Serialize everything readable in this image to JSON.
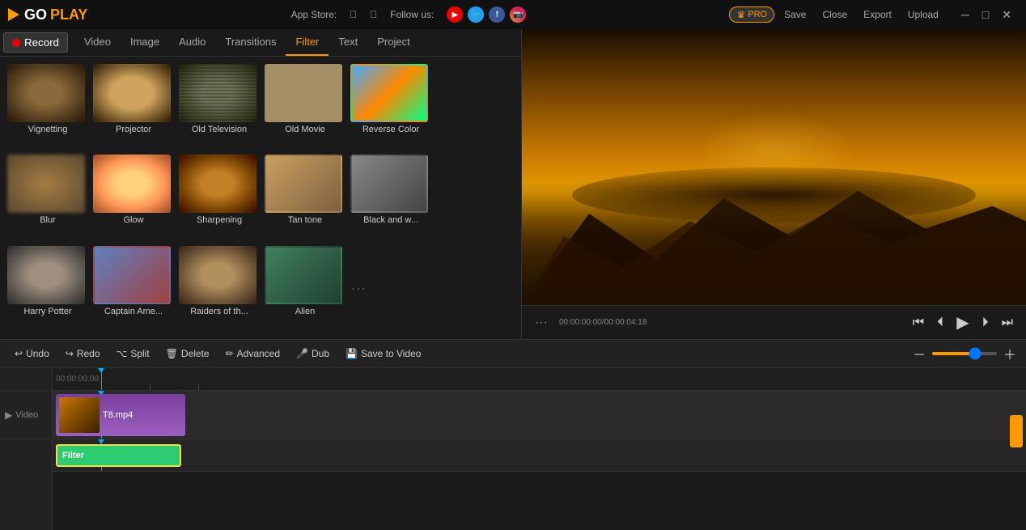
{
  "app": {
    "logo_go": "GO",
    "logo_play": "PLAY"
  },
  "titlebar": {
    "app_store_label": "App Store:",
    "follow_label": "Follow us:",
    "pro_label": "PRO",
    "save_btn": "Save",
    "close_btn": "Close",
    "export_btn": "Export",
    "upload_btn": "Upload"
  },
  "record_btn": "Record",
  "tabs": {
    "items": [
      {
        "label": "Video",
        "active": false
      },
      {
        "label": "Image",
        "active": false
      },
      {
        "label": "Audio",
        "active": false
      },
      {
        "label": "Transitions",
        "active": false
      },
      {
        "label": "Filter",
        "active": true
      },
      {
        "label": "Text",
        "active": false
      },
      {
        "label": "Project",
        "active": false
      }
    ]
  },
  "filters": [
    {
      "name": "Vignetting",
      "class": "ft-vignetting"
    },
    {
      "name": "Projector",
      "class": "ft-projector"
    },
    {
      "name": "Old Television",
      "class": "ft-old-tv"
    },
    {
      "name": "Old Movie",
      "class": "ft-old-movie"
    },
    {
      "name": "Reverse Color",
      "class": "ft-reverse"
    },
    {
      "name": "Blur",
      "class": "ft-blur"
    },
    {
      "name": "Glow",
      "class": "ft-glow"
    },
    {
      "name": "Sharpening",
      "class": "ft-sharpening"
    },
    {
      "name": "Tan tone",
      "class": "ft-tan"
    },
    {
      "name": "Black and w...",
      "class": "ft-black-white"
    },
    {
      "name": "Harry Potter",
      "class": "ft-harry-potter"
    },
    {
      "name": "Captain Ame...",
      "class": "ft-captain"
    },
    {
      "name": "Raiders of th...",
      "class": "ft-raiders"
    },
    {
      "name": "Alien",
      "class": "ft-alien"
    }
  ],
  "player": {
    "time_display": "00:00:00:00/00:00:04:18"
  },
  "bottom_toolbar": {
    "undo": "Undo",
    "redo": "Redo",
    "split": "Split",
    "delete": "Delete",
    "advanced": "Advanced",
    "dub": "Dub",
    "save_to_video": "Save to Video"
  },
  "timeline": {
    "ruler_time": "00:00:00:00",
    "video_label": "Video",
    "clip_name": "T8.mp4",
    "filter_label": "Filter"
  }
}
